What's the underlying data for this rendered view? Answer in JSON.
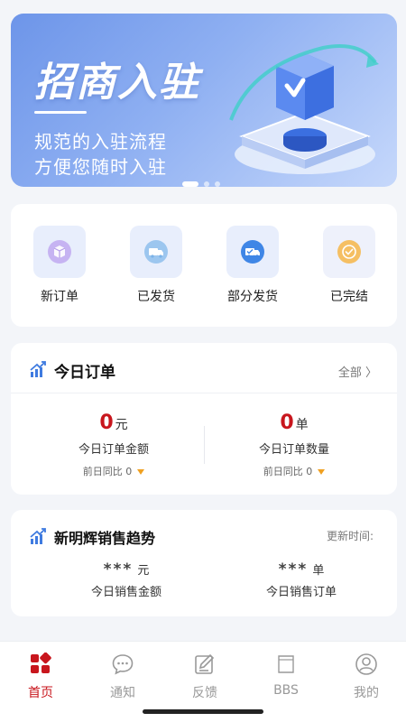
{
  "banner": {
    "title": "招商入驻",
    "line1": "规范的入驻流程",
    "line2": "方便您随时入驻",
    "slide_count": 3,
    "active_slide": 1
  },
  "status_items": [
    {
      "label": "新订单",
      "icon": "new-order-box-icon",
      "color": "#b39be8"
    },
    {
      "label": "已发货",
      "icon": "shipped-truck-icon",
      "color": "#7bb2e8"
    },
    {
      "label": "部分发货",
      "icon": "partial-shipment-truck-icon",
      "color": "#3f86e6"
    },
    {
      "label": "已完结",
      "icon": "completed-check-icon",
      "color": "#f3b24a"
    }
  ],
  "today_orders": {
    "title": "今日订单",
    "link": "全部 〉",
    "amount": {
      "value": "0",
      "unit": "元",
      "label": "今日订单金额",
      "compare": "前日同比 0"
    },
    "count": {
      "value": "0",
      "unit": "单",
      "label": "今日订单数量",
      "compare": "前日同比 0"
    }
  },
  "sales_trend": {
    "title": "新明辉销售趋势",
    "update_label": "更新时间:",
    "amount": {
      "value": "***",
      "unit": "元",
      "label": "今日销售金额"
    },
    "orders": {
      "value": "***",
      "unit": "单",
      "label": "今日销售订单"
    }
  },
  "tabs": [
    {
      "label": "首页",
      "icon": "home-grid-icon",
      "active": true
    },
    {
      "label": "通知",
      "icon": "chat-bubble-icon",
      "active": false
    },
    {
      "label": "反馈",
      "icon": "edit-note-icon",
      "active": false
    },
    {
      "label": "BBS",
      "icon": "bbs-icon",
      "active": false
    },
    {
      "label": "我的",
      "icon": "user-profile-icon",
      "active": false
    }
  ],
  "colors": {
    "accent": "#c8161d",
    "banner": "#7a9fee",
    "page_bg": "#f3f5f9"
  }
}
